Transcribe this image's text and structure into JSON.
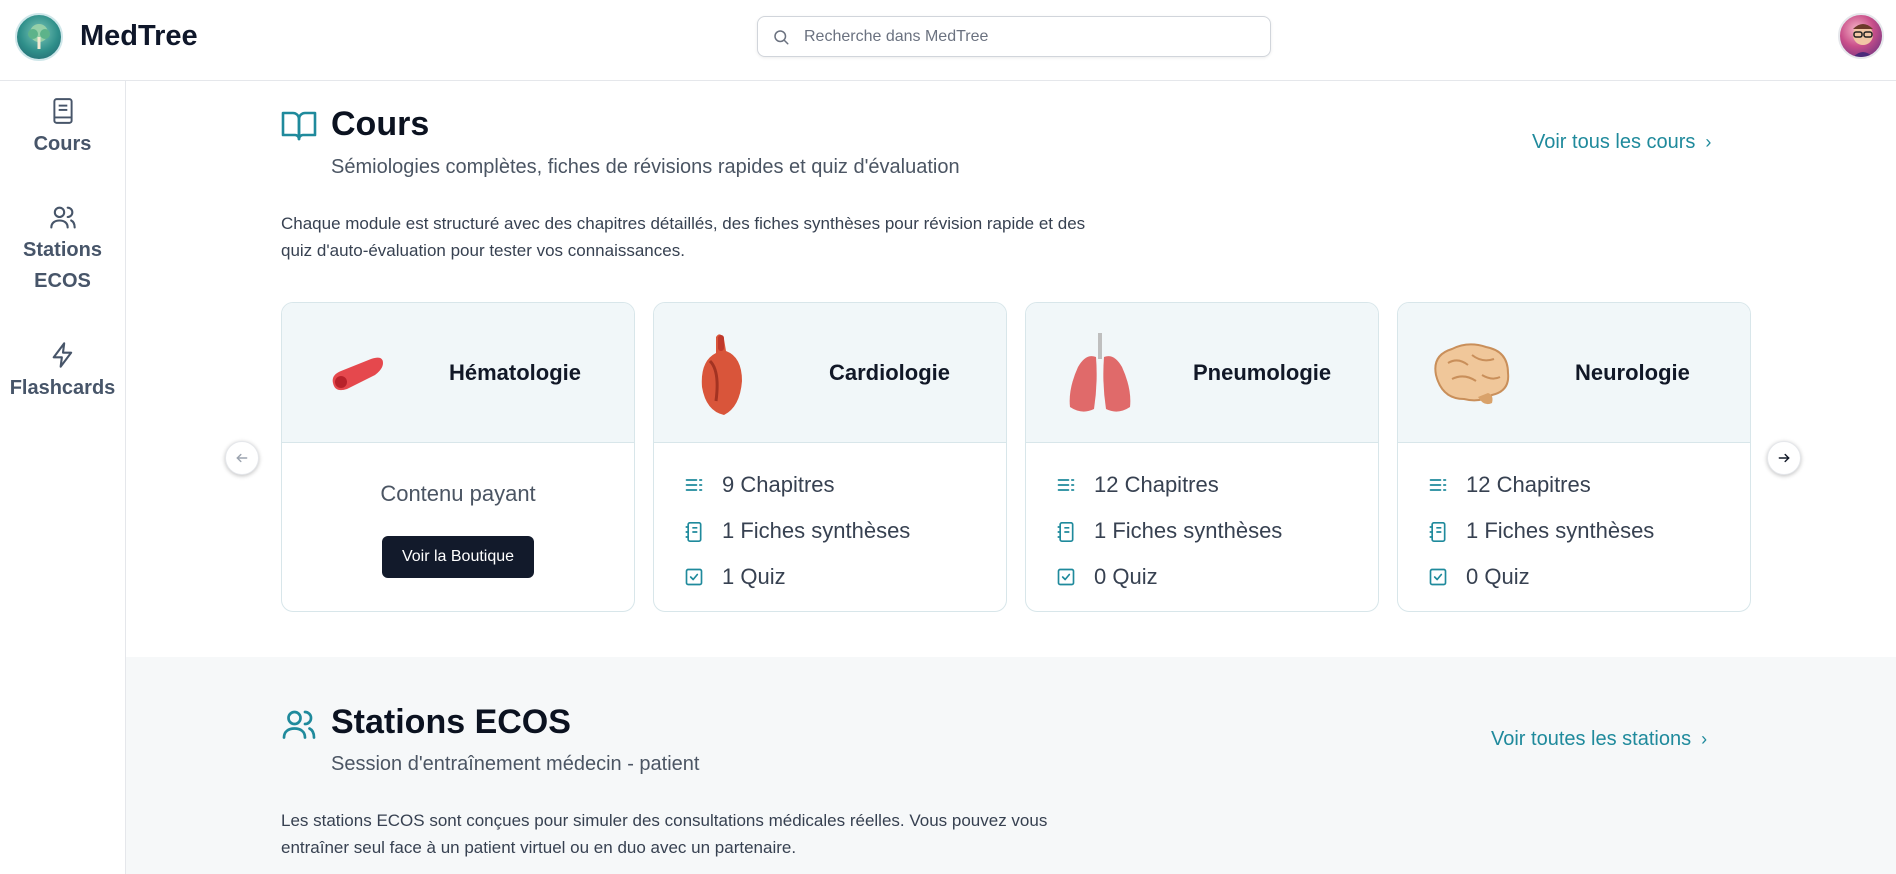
{
  "app": {
    "brand": "MedTree",
    "logo_icon": "tree-logo",
    "avatar_icon": "user-avatar"
  },
  "search": {
    "placeholder": "Recherche dans MedTree",
    "value": ""
  },
  "sidebar": {
    "items": [
      {
        "label": "Cours",
        "icon": "book-icon"
      },
      {
        "label": "Stations ECOS",
        "icon": "users-icon"
      },
      {
        "label": "Flashcards",
        "icon": "lightning-icon"
      }
    ]
  },
  "cours": {
    "title": "Cours",
    "subtitle": "Sémiologies complètes, fiches de révisions rapides et quiz d'évaluation",
    "description_line1": "Chaque module est structuré avec des chapitres détaillés, des fiches synthèses pour révision rapide et des",
    "description_line2": "quiz d'auto-évaluation pour tester vos connaissances.",
    "see_all": "Voir tous les cours",
    "cards": [
      {
        "name": "Hématologie",
        "paid_label": "Contenu payant",
        "button": "Voir la Boutique"
      },
      {
        "name": "Cardiologie",
        "chapters": "9 Chapitres",
        "sheets": "1 Fiches synthèses",
        "quiz": "1 Quiz"
      },
      {
        "name": "Pneumologie",
        "chapters": "12 Chapitres",
        "sheets": "1 Fiches synthèses",
        "quiz": "0 Quiz"
      },
      {
        "name": "Neurologie",
        "chapters": "12 Chapitres",
        "sheets": "1 Fiches synthèses",
        "quiz": "0 Quiz"
      }
    ]
  },
  "ecos": {
    "title": "Stations ECOS",
    "subtitle": "Session d'entraînement médecin - patient",
    "description_line1": "Les stations ECOS sont conçues pour simuler des consultations médicales réelles. Vous pouvez vous",
    "description_line2": "entraîner seul face à un patient virtuel ou en duo avec un partenaire.",
    "see_all": "Voir toutes les stations"
  },
  "colors": {
    "accent": "#1f8a9c",
    "dark_button": "#121a2b",
    "card_head": "#f1f7f9"
  }
}
